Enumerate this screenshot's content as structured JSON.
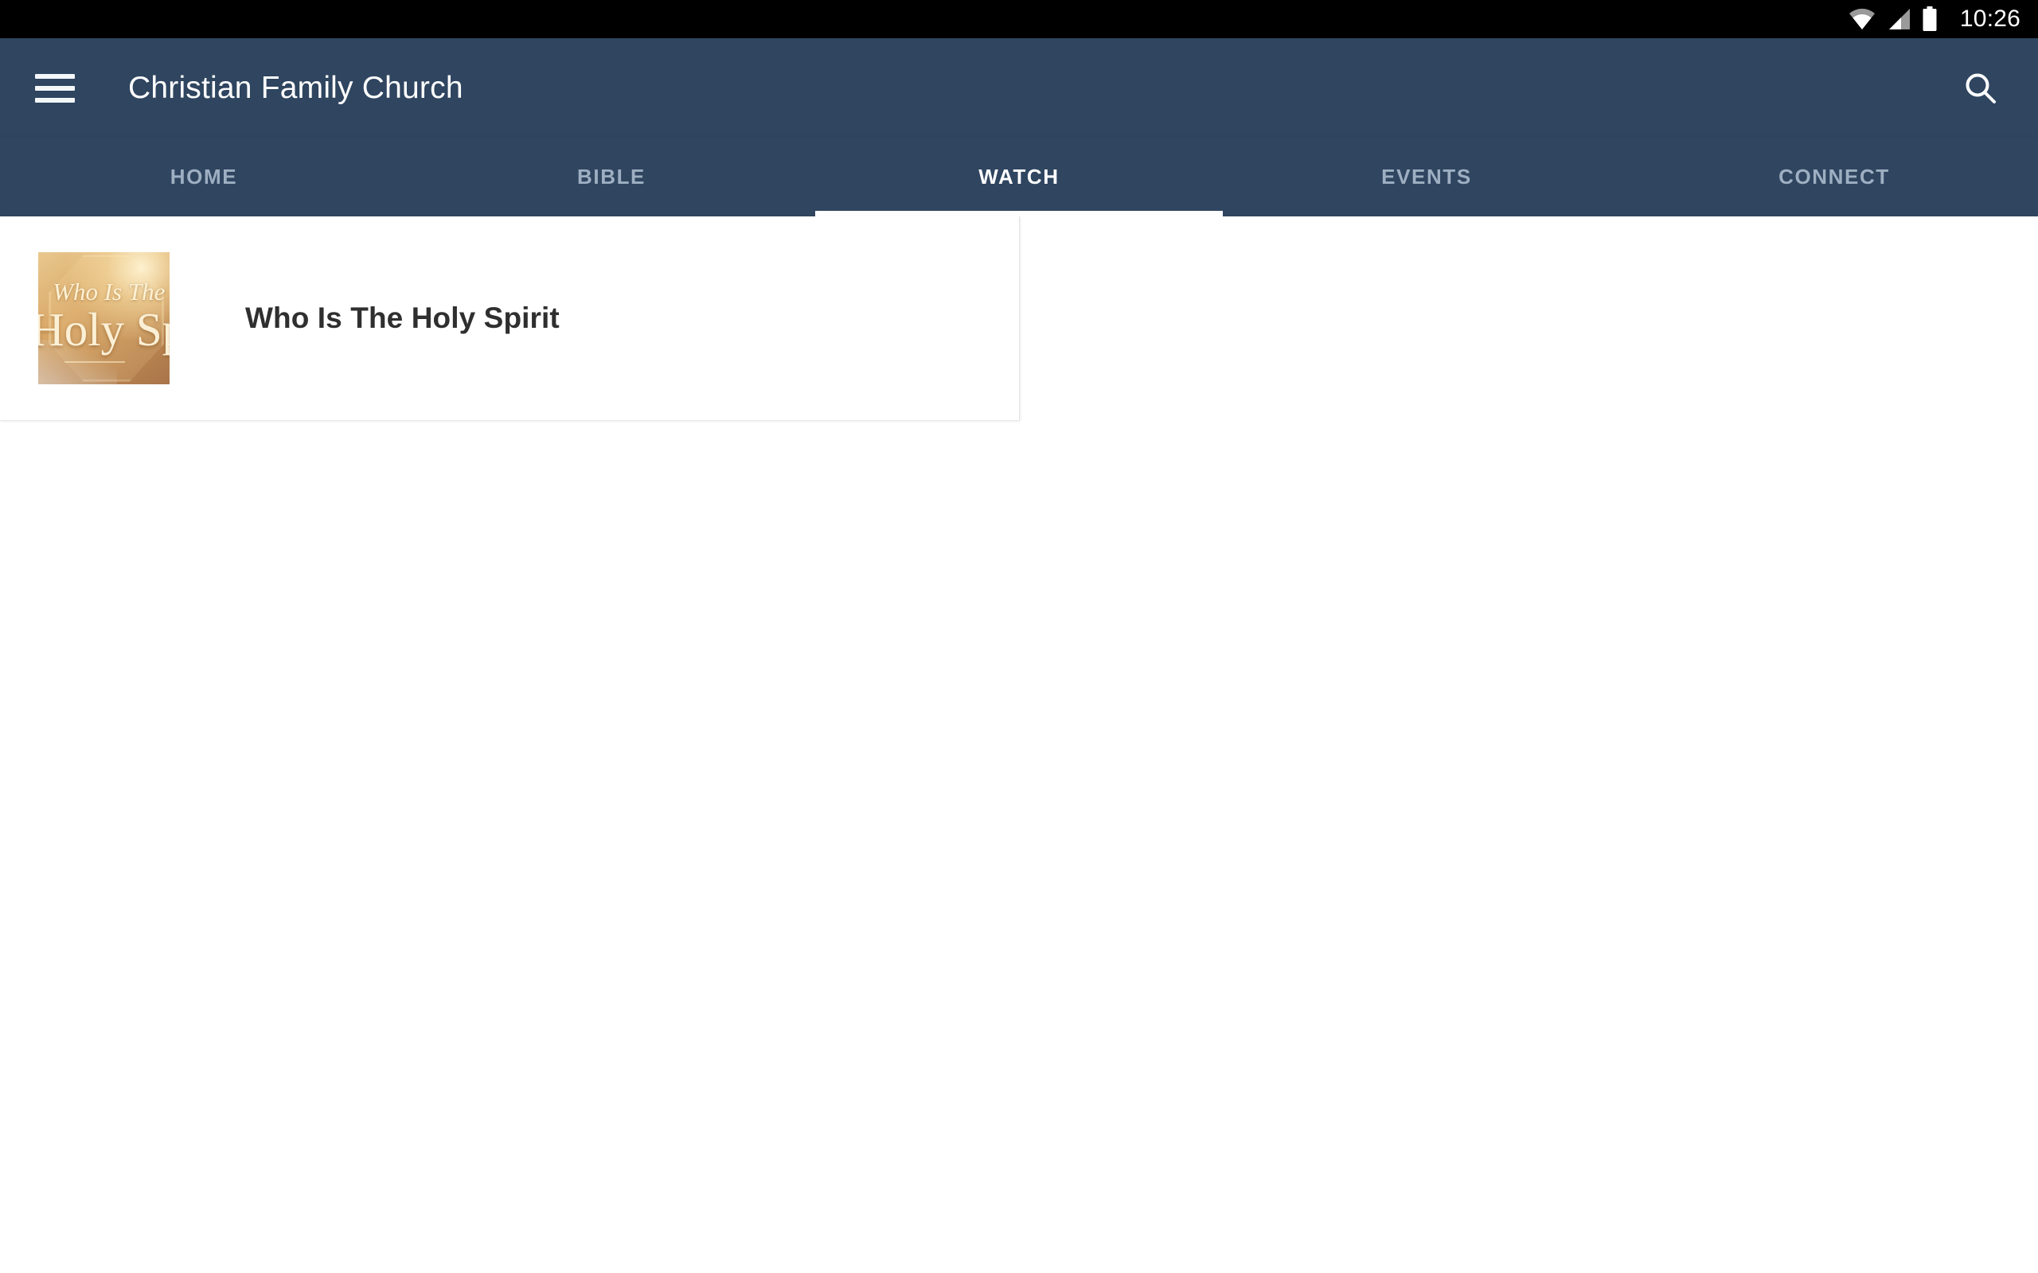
{
  "status_bar": {
    "time": "10:26",
    "icons": [
      "wifi-icon",
      "cellular-signal-icon",
      "battery-icon"
    ]
  },
  "app_bar": {
    "menu_icon": "hamburger-menu-icon",
    "title": "Christian Family Church",
    "search_icon": "search-icon"
  },
  "tabs": {
    "active_index": 2,
    "items": [
      {
        "label": "HOME"
      },
      {
        "label": "BIBLE"
      },
      {
        "label": "WATCH"
      },
      {
        "label": "EVENTS"
      },
      {
        "label": "CONNECT"
      }
    ]
  },
  "watch_list": {
    "items": [
      {
        "title": "Who Is The Holy Spirit",
        "thumbnail": {
          "line1": "Who Is The",
          "line2": "Holy Spirit"
        }
      }
    ]
  },
  "colors": {
    "app_bar": "#2f4560",
    "status_bar": "#000000",
    "tab_active": "#ffffff",
    "tab_inactive": "#9eafc2",
    "page_background": "#ffffff",
    "card_title": "#2f2f2f"
  }
}
